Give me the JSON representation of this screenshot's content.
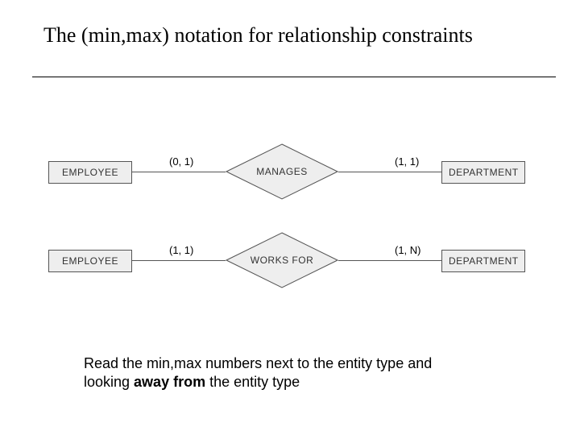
{
  "title": "The (min,max) notation for relationship constraints",
  "diagram": {
    "rows": [
      {
        "left_entity": "EMPLOYEE",
        "relationship": "MANAGES",
        "right_entity": "DEPARTMENT",
        "left_cardinality": "(0, 1)",
        "right_cardinality": "(1, 1)"
      },
      {
        "left_entity": "EMPLOYEE",
        "relationship": "WORKS FOR",
        "right_entity": "DEPARTMENT",
        "left_cardinality": "(1, 1)",
        "right_cardinality": "(1, N)"
      }
    ]
  },
  "explanation_parts": {
    "pre": "Read the min,max numbers next to the entity type and looking ",
    "bold": "away from",
    "post": " the entity type"
  }
}
